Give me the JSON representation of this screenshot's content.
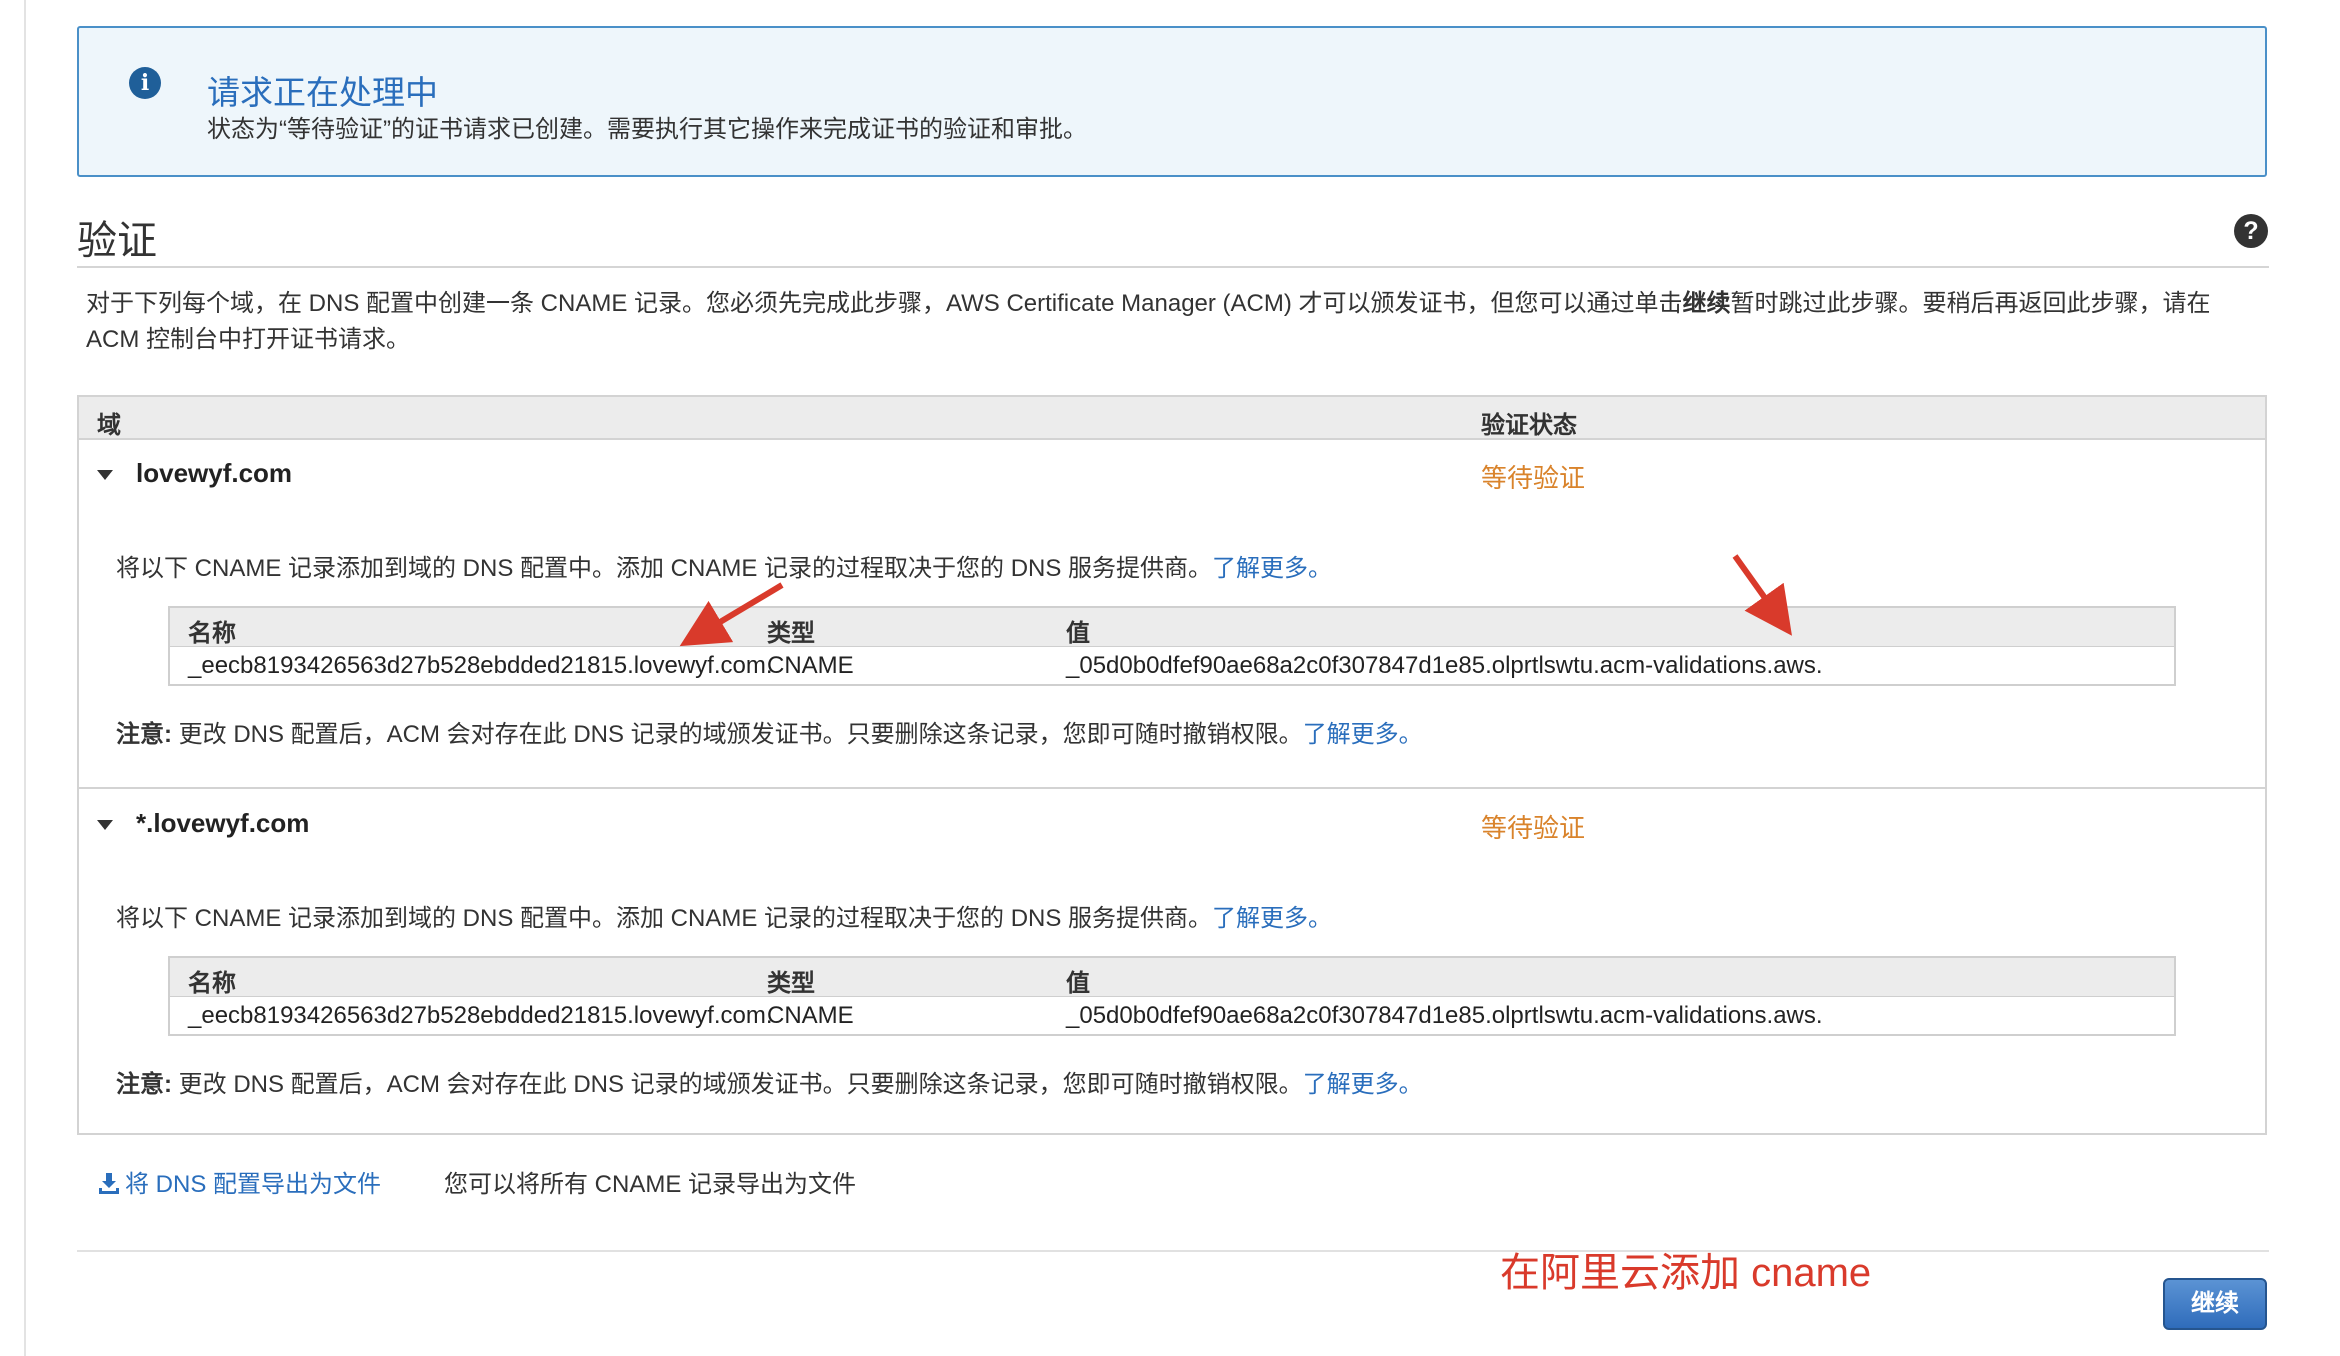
{
  "info": {
    "icon": "info-icon",
    "title": "请求正在处理中",
    "text": "状态为“等待验证”的证书请求已创建。需要执行其它操作来完成证书的验证和审批。"
  },
  "section": {
    "title": "验证",
    "help_icon": "help-icon",
    "intro_before_bold": "对于下列每个域，在 DNS 配置中创建一条 CNAME 记录。您必须先完成此步骤，AWS Certificate Manager (ACM) 才可以颁发证书，但您可以通过单击",
    "intro_bold": "继续",
    "intro_after_bold": "暂时跳过此步骤。要稍后再返回此步骤，请在 ACM 控制台中打开证书请求。"
  },
  "table": {
    "col_domain": "域",
    "col_status": "验证状态",
    "domains": [
      {
        "name": "lovewyf.com",
        "status": "等待验证",
        "desc": "将以下 CNAME 记录添加到域的 DNS 配置中。添加 CNAME 记录的过程取决于您的 DNS 服务提供商。",
        "learn_more": "了解更多。",
        "record": {
          "col_name": "名称",
          "col_type": "类型",
          "col_value": "值",
          "name": "_eecb8193426563d27b528ebdded21815.lovewyf.com.",
          "type": "CNAME",
          "value": "_05d0b0dfef90ae68a2c0f307847d1e85.olprtlswtu.acm-validations.aws."
        },
        "note_label": "注意:",
        "note_text": " 更改 DNS 配置后，ACM 会对存在此 DNS 记录的域颁发证书。只要删除这条记录，您即可随时撤销权限。",
        "note_link": "了解更多。"
      },
      {
        "name": "*.lovewyf.com",
        "status": "等待验证",
        "desc": "将以下 CNAME 记录添加到域的 DNS 配置中。添加 CNAME 记录的过程取决于您的 DNS 服务提供商。",
        "learn_more": "了解更多。",
        "record": {
          "col_name": "名称",
          "col_type": "类型",
          "col_value": "值",
          "name": "_eecb8193426563d27b528ebdded21815.lovewyf.com.",
          "type": "CNAME",
          "value": "_05d0b0dfef90ae68a2c0f307847d1e85.olprtlswtu.acm-validations.aws."
        },
        "note_label": "注意:",
        "note_text": " 更改 DNS 配置后，ACM 会对存在此 DNS 记录的域颁发证书。只要删除这条记录，您即可随时撤销权限。",
        "note_link": "了解更多。"
      }
    ]
  },
  "export": {
    "icon": "download-icon",
    "label": "将 DNS 配置导出为文件",
    "hint": "您可以将所有 CNAME 记录导出为文件"
  },
  "annotation": "在阿里云添加 cname",
  "continue_label": "继续",
  "colors": {
    "accent": "#2a6ebc",
    "pending": "#d9832b",
    "annotation": "#d93a2b",
    "info_bg": "#eef6fb"
  }
}
